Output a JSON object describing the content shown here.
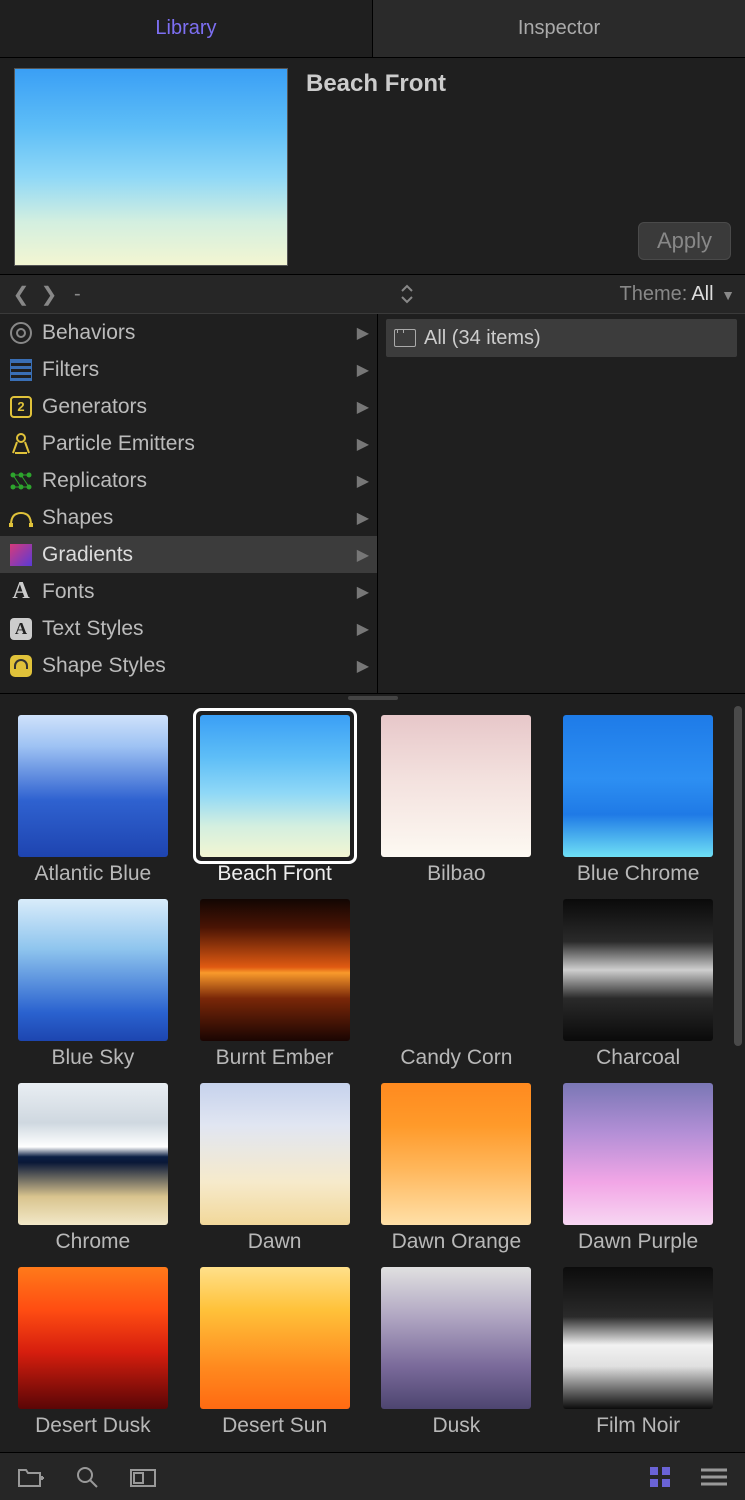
{
  "tabs": {
    "library": "Library",
    "inspector": "Inspector"
  },
  "preview": {
    "title": "Beach Front",
    "apply": "Apply"
  },
  "nav": {
    "path": "-",
    "theme_label": "Theme:",
    "theme_value": "All"
  },
  "categories": [
    {
      "label": "Behaviors"
    },
    {
      "label": "Filters"
    },
    {
      "label": "Generators"
    },
    {
      "label": "Particle Emitters"
    },
    {
      "label": "Replicators"
    },
    {
      "label": "Shapes"
    },
    {
      "label": "Gradients"
    },
    {
      "label": "Fonts"
    },
    {
      "label": "Text Styles"
    },
    {
      "label": "Shape Styles"
    }
  ],
  "subfolders": [
    {
      "label": "All (34 items)"
    }
  ],
  "gradients": [
    {
      "name": "Atlantic Blue",
      "css": "linear-gradient(to bottom,#cfe2fb 0%,#9ec2f3 22%,#2f62d0 60%,#1e44b0 100%)"
    },
    {
      "name": "Beach Front",
      "css": "linear-gradient(to bottom,#3a9ff5 0%,#5ebef7 30%,#8fd8f7 55%,#d3efe0 78%,#f3f6d2 100%)"
    },
    {
      "name": "Bilbao",
      "css": "linear-gradient(to bottom,#e7c7c9 0%,#f3e1de 45%,#fdf9f2 100%)"
    },
    {
      "name": "Blue Chrome",
      "css": "linear-gradient(to bottom,#1e7be8 0%,#2d8ff2 45%,#1f7ae6 70%,#6fe0f5 100%)"
    },
    {
      "name": "Blue Sky",
      "css": "linear-gradient(to bottom,#d9ecfa 0%,#8fc5ee 35%,#2a62cf 80%,#1d46b0 100%)"
    },
    {
      "name": "Burnt Ember",
      "css": "linear-gradient(to bottom,#120603 0%,#4a1404 20%,#e05a12 48%,#f99a2b 52%,#7a2708 70%,#1a0502 100%)"
    },
    {
      "name": "Candy Corn",
      "css": "linear-gradient(to bottom,#fffdek 0%,#fff6c9 15%,#ffb637 45%,#ff8e1f 70%,#ffc21a 100%)"
    },
    {
      "name": "Charcoal",
      "css": "linear-gradient(to bottom,#0a0a0a 0%,#2a2a2a 30%,#cfcfcf 50%,#2a2a2a 70%,#0a0a0a 100%)"
    },
    {
      "name": "Chrome",
      "css": "linear-gradient(to bottom,#e9eef3 0%,#cfd8e0 28%,#ffffff 45%,#0b1f44 52%,#0a1838 56%,#d9c48e 80%,#f2e8c8 100%)"
    },
    {
      "name": "Dawn",
      "css": "linear-gradient(to bottom,#c6d2ec 0%,#e1e6f2 30%,#f6eacb 70%,#f2d89a 100%)"
    },
    {
      "name": "Dawn Orange",
      "css": "linear-gradient(to bottom,#ff8a1f 0%,#ff9a2a 30%,#ffb65a 60%,#ffe0a8 100%)"
    },
    {
      "name": "Dawn Purple",
      "css": "linear-gradient(to bottom,#7a77b5 0%,#b38fd6 35%,#f2a6e6 70%,#f7d6f2 100%)"
    },
    {
      "name": "Desert Dusk",
      "css": "linear-gradient(to bottom,#ff7a1a 0%,#ff4d12 30%,#d61e0e 60%,#5a0606 100%)"
    },
    {
      "name": "Desert Sun",
      "css": "linear-gradient(to bottom,#ffe08a 0%,#ffc23a 30%,#ff8a1f 70%,#ff6a12 100%)"
    },
    {
      "name": "Dusk",
      "css": "linear-gradient(to bottom,#e0e0e0 0%,#b0a6c2 35%,#7a6a9a 70%,#4d4570 100%)"
    },
    {
      "name": "Film Noir",
      "css": "linear-gradient(to bottom,#0c0c0c 0%,#2a2a2a 35%,#f2f2f2 55%,#e0e0e0 70%,#0c0c0c 100%)"
    }
  ],
  "selected_gradient_index": 1,
  "selected_category_index": 6
}
